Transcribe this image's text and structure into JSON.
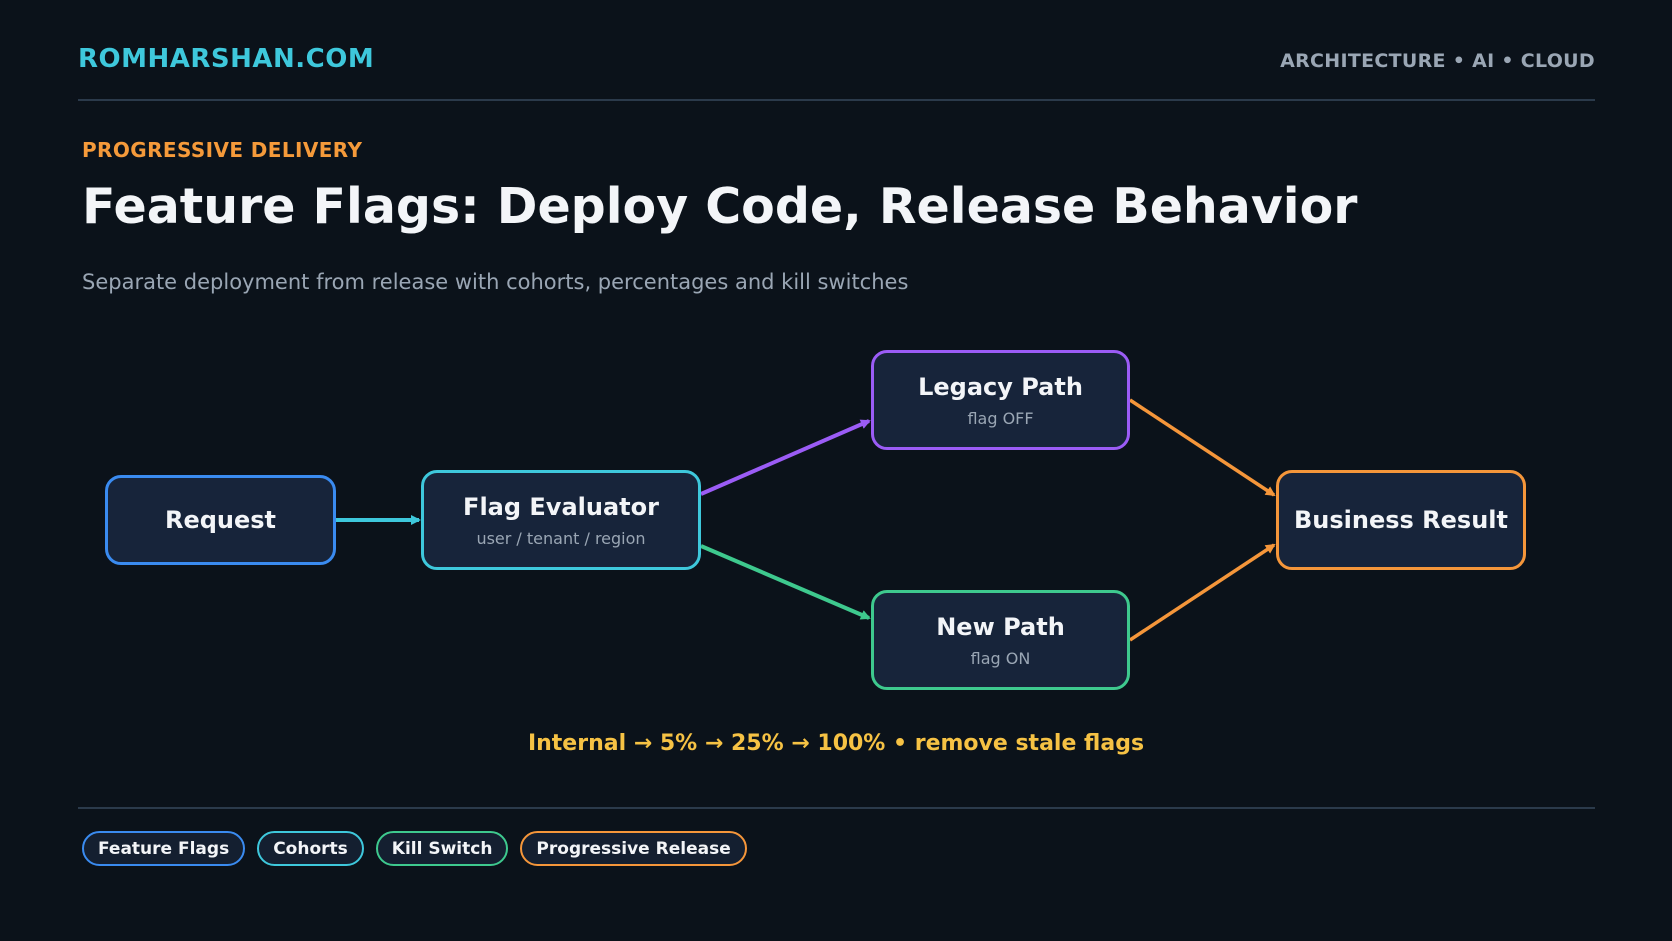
{
  "header": {
    "brand": "ROMHARSHAN.COM",
    "tagline": "ARCHITECTURE • AI • CLOUD"
  },
  "eyebrow": "PROGRESSIVE DELIVERY",
  "title": "Feature Flags: Deploy Code, Release Behavior",
  "subtitle": "Separate deployment from release with cohorts, percentages and kill switches",
  "diagram": {
    "nodes": {
      "request": {
        "label": "Request",
        "color": "#3a8bf0"
      },
      "evaluator": {
        "label": "Flag Evaluator",
        "sub": "user / tenant / region",
        "color": "#3ec8dc"
      },
      "legacy": {
        "label": "Legacy Path",
        "sub": "flag OFF",
        "color": "#9b5cf6"
      },
      "new_path": {
        "label": "New Path",
        "sub": "flag ON",
        "color": "#3ec98e"
      },
      "result": {
        "label": "Business Result",
        "color": "#f5963a"
      }
    },
    "edges": [
      {
        "from": "request",
        "to": "evaluator",
        "color": "#3ec8dc"
      },
      {
        "from": "evaluator",
        "to": "legacy",
        "color": "#9b5cf6"
      },
      {
        "from": "evaluator",
        "to": "new_path",
        "color": "#3ec98e"
      },
      {
        "from": "legacy",
        "to": "result",
        "color": "#f5963a"
      },
      {
        "from": "new_path",
        "to": "result",
        "color": "#f5963a"
      }
    ]
  },
  "rollout_note": "Internal → 5% → 25% → 100% • remove stale flags",
  "tags": [
    {
      "label": "Feature Flags",
      "color": "#3a8bf0"
    },
    {
      "label": "Cohorts",
      "color": "#3ec8dc"
    },
    {
      "label": "Kill Switch",
      "color": "#3ec98e"
    },
    {
      "label": "Progressive Release",
      "color": "#f5963a"
    }
  ]
}
